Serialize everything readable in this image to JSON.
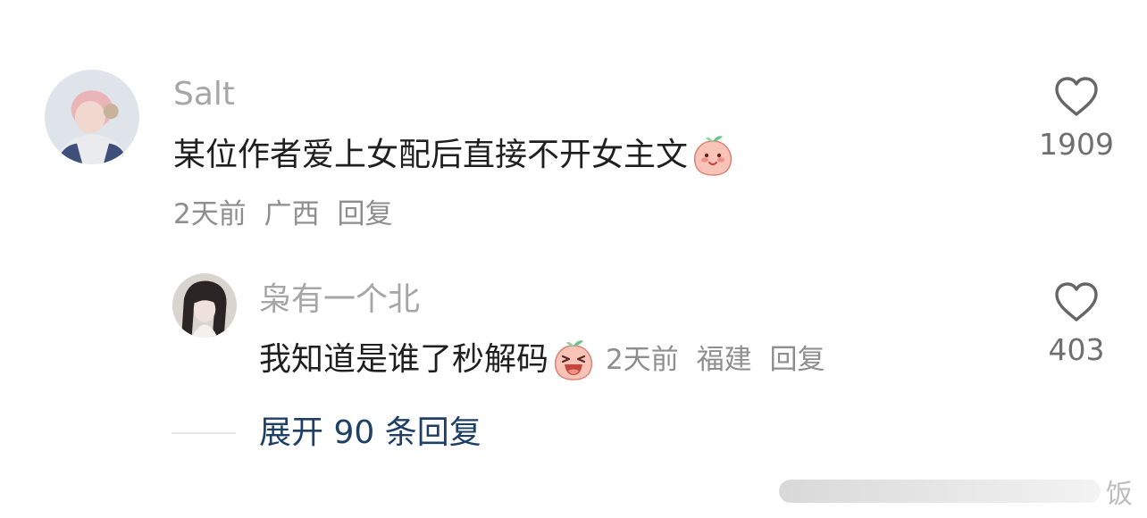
{
  "comment": {
    "username": "Salt",
    "text": "某位作者爱上女配后直接不开女主文",
    "emoji": "smiling-peach-emoji",
    "time": "2天前",
    "location": "广西",
    "reply_label": "回复",
    "like_count": "1909"
  },
  "reply": {
    "username": "枭有一个北",
    "text": "我知道是谁了秒解码",
    "emoji": "laughing-peach-emoji",
    "time": "2天前",
    "location": "福建",
    "reply_label": "回复",
    "like_count": "403"
  },
  "expand_replies": "展开 90 条回复",
  "watermark": "饭",
  "colors": {
    "username": "#a6a6a6",
    "meta": "#8e8e8e",
    "link": "#1e3f66",
    "emoji_fill": "#f9c3b8"
  }
}
